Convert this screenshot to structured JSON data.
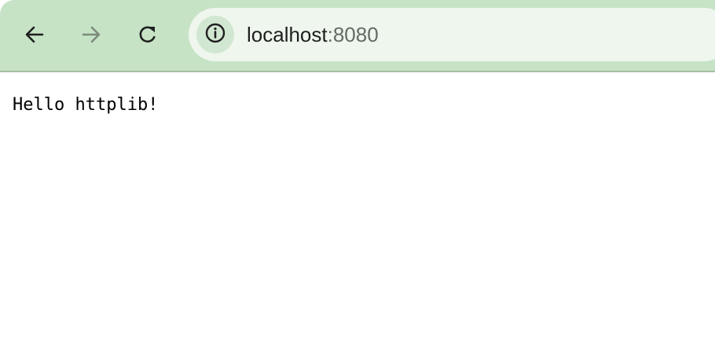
{
  "browser": {
    "address_bar": {
      "host": "localhost",
      "port": ":8080"
    },
    "icons": {
      "back": "back-arrow-icon",
      "forward": "forward-arrow-icon",
      "reload": "reload-icon",
      "site_info": "info-icon"
    },
    "colors": {
      "toolbar": "#c7e3c6",
      "address_bar": "#eef6ed",
      "site_info_button": "#d2e7d1",
      "forward_disabled": "#7c8a7c"
    }
  },
  "page": {
    "body_text": "Hello httplib!"
  }
}
